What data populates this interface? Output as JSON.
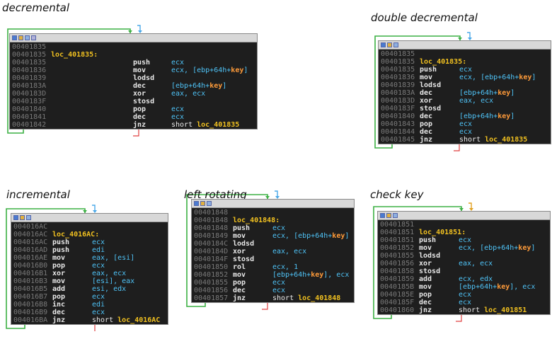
{
  "panels": [
    {
      "id": "decremental",
      "caption": "decremental",
      "icons": 4,
      "col_mn": 174,
      "col_op": 228,
      "lines": [
        {
          "addr": "00401835",
          "label": "",
          "mnem": "",
          "ops": []
        },
        {
          "addr": "00401835",
          "label": "loc_401835:",
          "mnem": "",
          "ops": []
        },
        {
          "addr": "00401835",
          "label": "",
          "mnem": "push",
          "ops": [
            {
              "t": "ecx",
              "c": "op"
            }
          ]
        },
        {
          "addr": "00401836",
          "label": "",
          "mnem": "mov",
          "ops": [
            {
              "t": "ecx, [ebp+64h+",
              "c": "op"
            },
            {
              "t": "key",
              "c": "k"
            },
            {
              "t": "]",
              "c": "op"
            }
          ]
        },
        {
          "addr": "00401839",
          "label": "",
          "mnem": "lodsd",
          "ops": []
        },
        {
          "addr": "0040183A",
          "label": "",
          "mnem": "dec",
          "ops": [
            {
              "t": "[ebp+64h+",
              "c": "op"
            },
            {
              "t": "key",
              "c": "k"
            },
            {
              "t": "]",
              "c": "op"
            }
          ]
        },
        {
          "addr": "0040183D",
          "label": "",
          "mnem": "xor",
          "ops": [
            {
              "t": "eax, ecx",
              "c": "op"
            }
          ]
        },
        {
          "addr": "0040183F",
          "label": "",
          "mnem": "stosd",
          "ops": []
        },
        {
          "addr": "00401840",
          "label": "",
          "mnem": "pop",
          "ops": [
            {
              "t": "ecx",
              "c": "op"
            }
          ]
        },
        {
          "addr": "00401841",
          "label": "",
          "mnem": "dec",
          "ops": [
            {
              "t": "ecx",
              "c": "op"
            }
          ]
        },
        {
          "addr": "00401842",
          "label": "",
          "mnem": "jnz",
          "ops": [
            {
              "t": "short ",
              "c": "w"
            },
            {
              "t": "loc_401835",
              "c": "y"
            }
          ]
        }
      ]
    },
    {
      "id": "double-decremental",
      "caption": "double decremental",
      "icons": 3,
      "col_mn": 58,
      "col_op": 114,
      "lines": [
        {
          "addr": "00401835",
          "label": "",
          "mnem": "",
          "ops": []
        },
        {
          "addr": "00401835",
          "label": "loc_401835:",
          "mnem": "",
          "ops": []
        },
        {
          "addr": "00401835",
          "label": "",
          "mnem": "push",
          "ops": [
            {
              "t": "ecx",
              "c": "op"
            }
          ]
        },
        {
          "addr": "00401836",
          "label": "",
          "mnem": "mov",
          "ops": [
            {
              "t": "ecx, [ebp+64h+",
              "c": "op"
            },
            {
              "t": "key",
              "c": "k"
            },
            {
              "t": "]",
              "c": "op"
            }
          ]
        },
        {
          "addr": "00401839",
          "label": "",
          "mnem": "lodsd",
          "ops": []
        },
        {
          "addr": "0040183A",
          "label": "",
          "mnem": "dec",
          "ops": [
            {
              "t": "[ebp+64h+",
              "c": "op"
            },
            {
              "t": "key",
              "c": "k"
            },
            {
              "t": "]",
              "c": "op"
            }
          ]
        },
        {
          "addr": "0040183D",
          "label": "",
          "mnem": "xor",
          "ops": [
            {
              "t": "eax, ecx",
              "c": "op"
            }
          ]
        },
        {
          "addr": "0040183F",
          "label": "",
          "mnem": "stosd",
          "ops": []
        },
        {
          "addr": "00401840",
          "label": "",
          "mnem": "dec",
          "ops": [
            {
              "t": "[ebp+64h+",
              "c": "op"
            },
            {
              "t": "key",
              "c": "k"
            },
            {
              "t": "]",
              "c": "op"
            }
          ]
        },
        {
          "addr": "00401843",
          "label": "",
          "mnem": "pop",
          "ops": [
            {
              "t": "ecx",
              "c": "op"
            }
          ]
        },
        {
          "addr": "00401844",
          "label": "",
          "mnem": "dec",
          "ops": [
            {
              "t": "ecx",
              "c": "op"
            }
          ]
        },
        {
          "addr": "00401845",
          "label": "",
          "mnem": "jnz",
          "ops": [
            {
              "t": "short ",
              "c": "w"
            },
            {
              "t": "loc_401835",
              "c": "y"
            }
          ]
        }
      ]
    },
    {
      "id": "incremental",
      "caption": "incremental",
      "icons": 3,
      "col_mn": 58,
      "col_op": 114,
      "lines": [
        {
          "addr": "004016AC",
          "label": "",
          "mnem": "",
          "ops": []
        },
        {
          "addr": "004016AC",
          "label": "loc_4016AC:",
          "mnem": "",
          "ops": []
        },
        {
          "addr": "004016AC",
          "label": "",
          "mnem": "push",
          "ops": [
            {
              "t": "ecx",
              "c": "op"
            }
          ]
        },
        {
          "addr": "004016AD",
          "label": "",
          "mnem": "push",
          "ops": [
            {
              "t": "edi",
              "c": "op"
            }
          ]
        },
        {
          "addr": "004016AE",
          "label": "",
          "mnem": "mov",
          "ops": [
            {
              "t": "eax, [esi]",
              "c": "op"
            }
          ]
        },
        {
          "addr": "004016B0",
          "label": "",
          "mnem": "pop",
          "ops": [
            {
              "t": "ecx",
              "c": "op"
            }
          ]
        },
        {
          "addr": "004016B1",
          "label": "",
          "mnem": "xor",
          "ops": [
            {
              "t": "eax, ecx",
              "c": "op"
            }
          ]
        },
        {
          "addr": "004016B3",
          "label": "",
          "mnem": "mov",
          "ops": [
            {
              "t": "[esi], eax",
              "c": "op"
            }
          ]
        },
        {
          "addr": "004016B5",
          "label": "",
          "mnem": "add",
          "ops": [
            {
              "t": "esi, edx",
              "c": "op"
            }
          ]
        },
        {
          "addr": "004016B7",
          "label": "",
          "mnem": "pop",
          "ops": [
            {
              "t": "ecx",
              "c": "op"
            }
          ]
        },
        {
          "addr": "004016B8",
          "label": "",
          "mnem": "inc",
          "ops": [
            {
              "t": "edi",
              "c": "op"
            }
          ]
        },
        {
          "addr": "004016B9",
          "label": "",
          "mnem": "dec",
          "ops": [
            {
              "t": "ecx",
              "c": "op"
            }
          ]
        },
        {
          "addr": "004016BA",
          "label": "",
          "mnem": "jnz",
          "ops": [
            {
              "t": "short ",
              "c": "w"
            },
            {
              "t": "loc_4016AC",
              "c": "y"
            }
          ]
        }
      ]
    },
    {
      "id": "left-rotating",
      "caption": "left rotating",
      "icons": 3,
      "col_mn": 58,
      "col_op": 114,
      "lines": [
        {
          "addr": "00401848",
          "label": "",
          "mnem": "",
          "ops": []
        },
        {
          "addr": "00401848",
          "label": "loc_401848:",
          "mnem": "",
          "ops": []
        },
        {
          "addr": "00401848",
          "label": "",
          "mnem": "push",
          "ops": [
            {
              "t": "ecx",
              "c": "op"
            }
          ]
        },
        {
          "addr": "00401849",
          "label": "",
          "mnem": "mov",
          "ops": [
            {
              "t": "ecx, [ebp+64h+",
              "c": "op"
            },
            {
              "t": "key",
              "c": "k"
            },
            {
              "t": "]",
              "c": "op"
            }
          ]
        },
        {
          "addr": "0040184C",
          "label": "",
          "mnem": "lodsd",
          "ops": []
        },
        {
          "addr": "0040184D",
          "label": "",
          "mnem": "xor",
          "ops": [
            {
              "t": "eax, ecx",
              "c": "op"
            }
          ]
        },
        {
          "addr": "0040184F",
          "label": "",
          "mnem": "stosd",
          "ops": []
        },
        {
          "addr": "00401850",
          "label": "",
          "mnem": "rol",
          "ops": [
            {
              "t": "ecx, 1",
              "c": "op"
            }
          ]
        },
        {
          "addr": "00401852",
          "label": "",
          "mnem": "mov",
          "ops": [
            {
              "t": "[ebp+64h+",
              "c": "op"
            },
            {
              "t": "key",
              "c": "k"
            },
            {
              "t": "], ecx",
              "c": "op"
            }
          ]
        },
        {
          "addr": "00401855",
          "label": "",
          "mnem": "pop",
          "ops": [
            {
              "t": "ecx",
              "c": "op"
            }
          ]
        },
        {
          "addr": "00401856",
          "label": "",
          "mnem": "dec",
          "ops": [
            {
              "t": "ecx",
              "c": "op"
            }
          ]
        },
        {
          "addr": "00401857",
          "label": "",
          "mnem": "jnz",
          "ops": [
            {
              "t": "short ",
              "c": "w"
            },
            {
              "t": "loc_401848",
              "c": "y"
            }
          ]
        }
      ]
    },
    {
      "id": "check-key",
      "caption": "check key",
      "icons": 3,
      "col_mn": 58,
      "col_op": 114,
      "lines": [
        {
          "addr": "00401851",
          "label": "",
          "mnem": "",
          "ops": []
        },
        {
          "addr": "00401851",
          "label": "loc_401851:",
          "mnem": "",
          "ops": []
        },
        {
          "addr": "00401851",
          "label": "",
          "mnem": "push",
          "ops": [
            {
              "t": "ecx",
              "c": "op"
            }
          ]
        },
        {
          "addr": "00401852",
          "label": "",
          "mnem": "mov",
          "ops": [
            {
              "t": "ecx, [ebp+64h+",
              "c": "op"
            },
            {
              "t": "key",
              "c": "k"
            },
            {
              "t": "]",
              "c": "op"
            }
          ]
        },
        {
          "addr": "00401855",
          "label": "",
          "mnem": "lodsd",
          "ops": []
        },
        {
          "addr": "00401856",
          "label": "",
          "mnem": "xor",
          "ops": [
            {
              "t": "eax, ecx",
              "c": "op"
            }
          ]
        },
        {
          "addr": "00401858",
          "label": "",
          "mnem": "stosd",
          "ops": []
        },
        {
          "addr": "00401859",
          "label": "",
          "mnem": "add",
          "ops": [
            {
              "t": "ecx, edx",
              "c": "op"
            }
          ]
        },
        {
          "addr": "0040185B",
          "label": "",
          "mnem": "mov",
          "ops": [
            {
              "t": "[ebp+64h+",
              "c": "op"
            },
            {
              "t": "key",
              "c": "k"
            },
            {
              "t": "], ecx",
              "c": "op"
            }
          ]
        },
        {
          "addr": "0040185E",
          "label": "",
          "mnem": "pop",
          "ops": [
            {
              "t": "ecx",
              "c": "op"
            }
          ]
        },
        {
          "addr": "0040185F",
          "label": "",
          "mnem": "dec",
          "ops": [
            {
              "t": "ecx",
              "c": "op"
            }
          ]
        },
        {
          "addr": "00401860",
          "label": "",
          "mnem": "jnz",
          "ops": [
            {
              "t": "short ",
              "c": "w"
            },
            {
              "t": "loc_401851",
              "c": "y"
            }
          ]
        }
      ]
    }
  ],
  "colors": {
    "loop_edge": "#3cb043",
    "blue_arrow": "#4aa8e8",
    "orange_arrow": "#e0a020",
    "exit_edge": "#e04040"
  }
}
